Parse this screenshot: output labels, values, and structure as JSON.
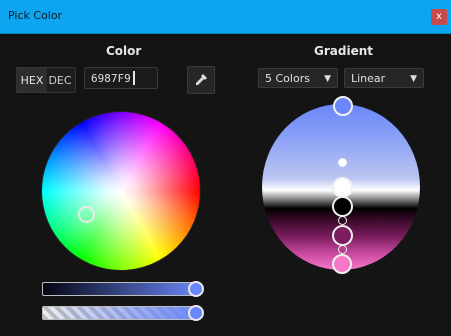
{
  "window": {
    "title": "Pick Color",
    "close_label": "x"
  },
  "color_panel": {
    "title": "Color",
    "mode_buttons": [
      "HEX",
      "DEC"
    ],
    "hex_value": "6987F9",
    "eyedropper_icon": "eyedropper-icon",
    "current_color": "#6987F9",
    "brightness": 1.0,
    "alpha": 1.0
  },
  "gradient_panel": {
    "title": "Gradient",
    "stops_select": "5 Colors",
    "mode_select": "Linear",
    "stop_colors": [
      "#6987F9",
      "#ffffff",
      "#000000",
      "#7b1d5e",
      "#f878c8"
    ]
  }
}
